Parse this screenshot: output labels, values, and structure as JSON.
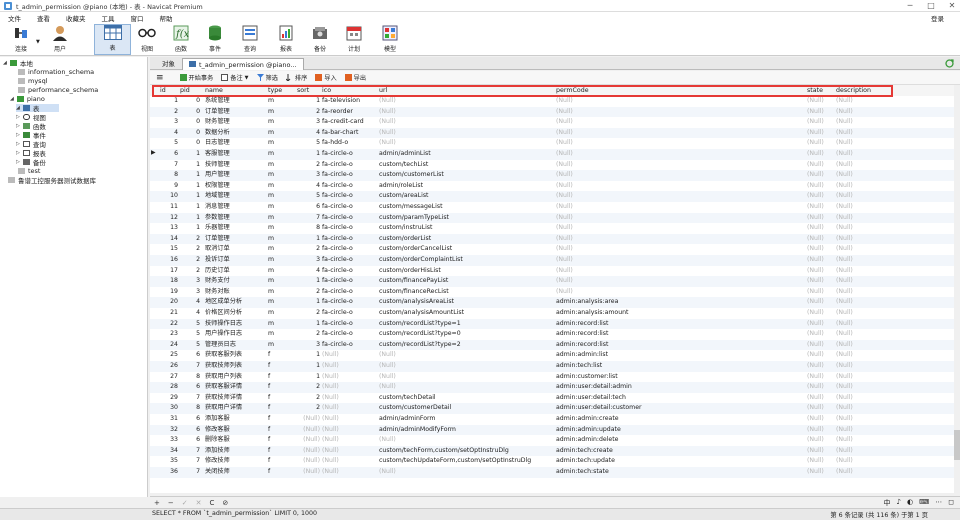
{
  "window": {
    "title": "t_admin_permission @piano (本地) - 表 - Navicat Premium",
    "min": "─",
    "max": "□",
    "close": "✕"
  },
  "menu": [
    "文件",
    "查看",
    "收藏夹",
    "工具",
    "窗口",
    "帮助"
  ],
  "login": "登录",
  "toolbar": {
    "connect": "连接",
    "user": "用户",
    "table": "表",
    "view": "视图",
    "function": "函数",
    "event": "事件",
    "query": "查询",
    "report": "报表",
    "backup": "备份",
    "schedule": "计划",
    "model": "模型"
  },
  "sidebar": {
    "connection": "本地",
    "databases": [
      "information_schema",
      "mysql",
      "performance_schema",
      "piano",
      "test",
      "鲁谱工控服务器测试数据库"
    ],
    "piano_children": [
      "表",
      "视图",
      "函数",
      "事件",
      "查询",
      "报表",
      "备份"
    ]
  },
  "tabs": {
    "objects": "对象",
    "table": "t_admin_permission @piano..."
  },
  "grid_toolbar": {
    "menu": "≡",
    "begin_tx": "开始事务",
    "memo": "备注",
    "filter": "筛选",
    "sort": "排序",
    "import": "导入",
    "export": "导出"
  },
  "columns": [
    "id",
    "pid",
    "name",
    "type",
    "sort",
    "ico",
    "url",
    "permCode",
    "state",
    "description"
  ],
  "null_text": "(Null)",
  "rows": [
    [
      1,
      0,
      "系统管理",
      "m",
      1,
      "fa-television",
      null,
      null,
      null,
      null
    ],
    [
      2,
      0,
      "订单管理",
      "m",
      2,
      "fa-reorder",
      null,
      null,
      null,
      null
    ],
    [
      3,
      0,
      "财务管理",
      "m",
      3,
      "fa-credit-card",
      null,
      null,
      null,
      null
    ],
    [
      4,
      0,
      "数据分析",
      "m",
      4,
      "fa-bar-chart",
      null,
      null,
      null,
      null
    ],
    [
      5,
      0,
      "日志管理",
      "m",
      5,
      "fa-hdd-o",
      null,
      null,
      null,
      null
    ],
    [
      6,
      1,
      "客服管理",
      "m",
      1,
      "fa-circle-o",
      "admin/adminList",
      null,
      null,
      null
    ],
    [
      7,
      1,
      "技师管理",
      "m",
      2,
      "fa-circle-o",
      "custom/techList",
      null,
      null,
      null
    ],
    [
      8,
      1,
      "用户管理",
      "m",
      3,
      "fa-circle-o",
      "custom/customerList",
      null,
      null,
      null
    ],
    [
      9,
      1,
      "权限管理",
      "m",
      4,
      "fa-circle-o",
      "admin/roleList",
      null,
      null,
      null
    ],
    [
      10,
      1,
      "地域管理",
      "m",
      5,
      "fa-circle-o",
      "custom/areaList",
      null,
      null,
      null
    ],
    [
      11,
      1,
      "消息管理",
      "m",
      6,
      "fa-circle-o",
      "custom/messageList",
      null,
      null,
      null
    ],
    [
      12,
      1,
      "参数管理",
      "m",
      7,
      "fa-circle-o",
      "custom/paramTypeList",
      null,
      null,
      null
    ],
    [
      13,
      1,
      "乐器管理",
      "m",
      8,
      "fa-circle-o",
      "custom/instruList",
      null,
      null,
      null
    ],
    [
      14,
      2,
      "订单管理",
      "m",
      1,
      "fa-circle-o",
      "custom/orderList",
      null,
      null,
      null
    ],
    [
      15,
      2,
      "取消订单",
      "m",
      2,
      "fa-circle-o",
      "custom/orderCancelList",
      null,
      null,
      null
    ],
    [
      16,
      2,
      "投诉订单",
      "m",
      3,
      "fa-circle-o",
      "custom/orderComplaintList",
      null,
      null,
      null
    ],
    [
      17,
      2,
      "历史订单",
      "m",
      4,
      "fa-circle-o",
      "custom/orderHisList",
      null,
      null,
      null
    ],
    [
      18,
      3,
      "财务支付",
      "m",
      1,
      "fa-circle-o",
      "custom/financePayList",
      null,
      null,
      null
    ],
    [
      19,
      3,
      "财务对账",
      "m",
      2,
      "fa-circle-o",
      "custom/financeRecList",
      null,
      null,
      null
    ],
    [
      20,
      4,
      "地区成单分析",
      "m",
      1,
      "fa-circle-o",
      "custom/analysisAreaList",
      "admin:analysis:area",
      null,
      null
    ],
    [
      21,
      4,
      "价格区间分析",
      "m",
      2,
      "fa-circle-o",
      "custom/analysisAmountList",
      "admin:analysis:amount",
      null,
      null
    ],
    [
      22,
      5,
      "技师操作日志",
      "m",
      1,
      "fa-circle-o",
      "custom/recordList?type=1",
      "admin:record:list",
      null,
      null
    ],
    [
      23,
      5,
      "用户操作日志",
      "m",
      2,
      "fa-circle-o",
      "custom/recordList?type=0",
      "admin:record:list",
      null,
      null
    ],
    [
      24,
      5,
      "管理员日志",
      "m",
      3,
      "fa-circle-o",
      "custom/recordList?type=2",
      "admin:record:list",
      null,
      null
    ],
    [
      25,
      6,
      "获取客服列表",
      "f",
      1,
      null,
      null,
      "admin:admin:list",
      null,
      null
    ],
    [
      26,
      7,
      "获取技师列表",
      "f",
      1,
      null,
      null,
      "admin:tech:list",
      null,
      null
    ],
    [
      27,
      8,
      "获取用户列表",
      "f",
      1,
      null,
      null,
      "admin:customer:list",
      null,
      null
    ],
    [
      28,
      6,
      "获取客服详情",
      "f",
      2,
      null,
      null,
      "admin:user:detail:admin",
      null,
      null
    ],
    [
      29,
      7,
      "获取技师详情",
      "f",
      2,
      null,
      "custom/techDetail",
      "admin:user:detail:tech",
      null,
      null
    ],
    [
      30,
      8,
      "获取用户详情",
      "f",
      2,
      null,
      "custom/customerDetail",
      "admin:user:detail:customer",
      null,
      null
    ],
    [
      31,
      6,
      "添加客服",
      "f",
      null,
      null,
      "admin/adminForm",
      "admin:admin:create",
      null,
      null
    ],
    [
      32,
      6,
      "修改客服",
      "f",
      null,
      null,
      "admin/adminModifyForm",
      "admin:admin:update",
      null,
      null
    ],
    [
      33,
      6,
      "删除客服",
      "f",
      null,
      null,
      null,
      "admin:admin:delete",
      null,
      null
    ],
    [
      34,
      7,
      "添加技师",
      "f",
      null,
      null,
      "custom/techForm,custom/setOptInstruDlg",
      "admin:tech:create",
      null,
      null
    ],
    [
      35,
      7,
      "修改技师",
      "f",
      null,
      null,
      "custom/techUpdateForm,custom/setOptInstruDlg",
      "admin:tech:update",
      null,
      null
    ],
    [
      36,
      7,
      "关闭技师",
      "f",
      null,
      null,
      null,
      "admin:tech:state",
      null,
      null
    ]
  ],
  "selected_row_id": 6,
  "navbar": [
    "+",
    "−",
    "✓",
    "✕",
    "C",
    "⊘"
  ],
  "tray": [
    "中",
    "♪",
    "◐",
    "⌨",
    "⋯",
    "◻"
  ],
  "status": {
    "sql": "SELECT * FROM `t_admin_permission` LIMIT 0, 1000",
    "records": "第 6 条记录 (共 116 条) 于第 1 页"
  }
}
